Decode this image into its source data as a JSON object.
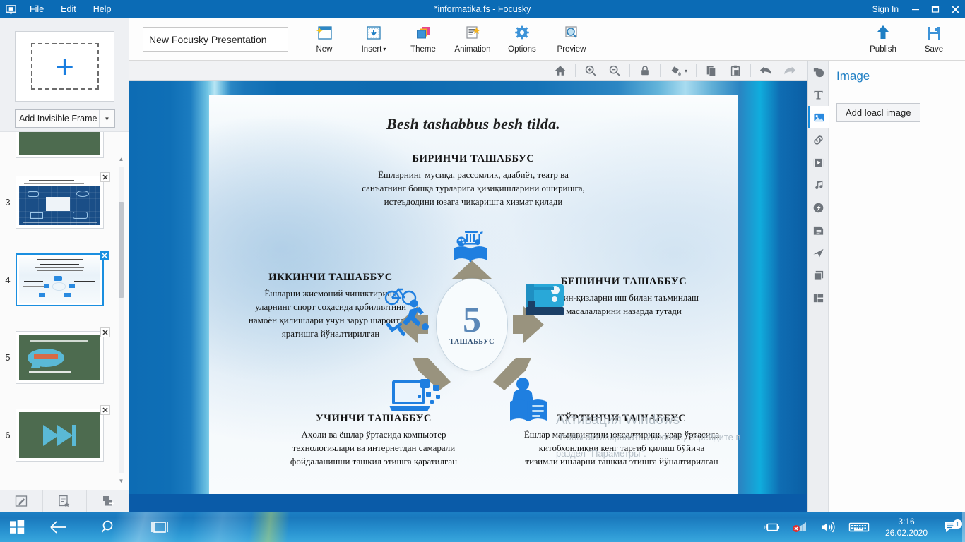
{
  "titlebar": {
    "menus": [
      "File",
      "Edit",
      "Help"
    ],
    "title": "*informatika.fs - Focusky",
    "signin": "Sign In",
    "minimize": "–",
    "restore": "❐",
    "close": "✕"
  },
  "ribbon": {
    "presentation_title": "New Focusky Presentation",
    "tools": [
      {
        "label": "New",
        "icon": "new-slide-icon"
      },
      {
        "label": "Insert",
        "icon": "insert-icon",
        "caret": "▾"
      },
      {
        "label": "Theme",
        "icon": "theme-icon"
      },
      {
        "label": "Animation",
        "icon": "animation-icon"
      },
      {
        "label": "Options",
        "icon": "options-gear-icon"
      },
      {
        "label": "Preview",
        "icon": "preview-magnifier-icon"
      }
    ],
    "right_tools": [
      {
        "label": "Publish",
        "icon": "publish-upload-icon"
      },
      {
        "label": "Save",
        "icon": "save-floppy-icon"
      }
    ]
  },
  "left_panel": {
    "add_frame_label": "Add Invisible Frame",
    "add_frame_caret": "▼",
    "plus": "+",
    "thumbnails": [
      {
        "number": "",
        "kind": "green-partial",
        "selected": false
      },
      {
        "number": "3",
        "kind": "blueprint",
        "selected": false
      },
      {
        "number": "4",
        "kind": "current-slide",
        "selected": true
      },
      {
        "number": "5",
        "kind": "green-bubble",
        "bubble_text": "Internet",
        "caption": "Axborot nima?",
        "selected": false
      },
      {
        "number": "6",
        "kind": "green-next",
        "selected": false
      }
    ],
    "scroll_up": "▲",
    "scroll_down": "▼",
    "bottom_buttons": [
      "edit-frame-icon",
      "add-note-icon",
      "duplicate-frame-icon"
    ]
  },
  "canvas_toolbar": {
    "buttons": [
      "home-icon",
      "zoom-in-icon",
      "zoom-out-icon",
      "lock-icon",
      "fill-color-icon",
      "copy-icon",
      "paste-icon",
      "undo-icon",
      "redo-icon"
    ],
    "fill_caret": "▾"
  },
  "slide": {
    "title": "Besh tashabbus besh tilda.",
    "center": {
      "number": "5",
      "label": "ТАШАББУС"
    },
    "blocks": [
      {
        "id": "blk1",
        "heading": "БИРИНЧИ ТАШАББУС",
        "lines": [
          "Ёшларнинг мусиқа, рассомлик, адабиёт, театр ва",
          "санъатнинг бошқа турларига қизиқишларини оширишга,",
          "истеъдодини юзага чиқаришга хизмат қилади"
        ]
      },
      {
        "id": "blk2",
        "heading": "ИККИНЧИ ТАШАББУС",
        "lines": [
          "Ёшларни жисмоний чиниктириш,",
          "уларнинг спорт соҳасида қобилиятини",
          "намоён қилишлари учун зарур шароитлар",
          "яратишга йўналтирилган"
        ]
      },
      {
        "id": "blk5",
        "heading": "БЕШИНЧИ ТАШАББУС",
        "lines": [
          "Хотин-қизларни иш билан таъминлаш",
          "масалаларини назарда тутади"
        ]
      },
      {
        "id": "blk3",
        "heading": "УЧИНЧИ ТАШАББУС",
        "lines": [
          "Аҳоли ва ёшлар ўртасида компьютер",
          "технологиялари ва интернетдан самарали",
          "фойдаланишни ташкил этишга қаратилган"
        ]
      },
      {
        "id": "blk4",
        "heading": "ТЎРТИНЧИ ТАШАББУС",
        "lines": [
          "Ёшлар маънавиятини юксалтириш, улар ўртасида",
          "китобхонликни кенг тарғиб қилиш бўйича",
          "тизимли ишларни ташкил этишга йўналтирилган"
        ]
      }
    ],
    "icons": [
      "culture-book-icon",
      "sports-bicycle-runner-icon",
      "sewing-machine-icon",
      "laptop-data-icon",
      "reading-person-icon"
    ]
  },
  "watermark": {
    "line1": "Активация Windows",
    "line2": "Чтобы активировать Windows, перейдите в",
    "line3": "раздел \"Параметры\"."
  },
  "right_panel": {
    "title": "Image",
    "add_button": "Add loacl image",
    "rail_icons": [
      "shape-icon",
      "text-icon",
      "image-icon",
      "link-icon",
      "video-icon",
      "music-icon",
      "flash-icon",
      "content-icon",
      "animation-path-icon",
      "layers-icon",
      "layout-icon"
    ]
  },
  "taskbar": {
    "start": "start-icon",
    "back": "back-arrow-icon",
    "search": "search-icon",
    "taskview": "task-view-icon",
    "tray": [
      "battery-icon",
      "network-disconnected-icon",
      "volume-icon",
      "keyboard-icon"
    ],
    "time": "3:16",
    "date": "26.02.2020",
    "notification_count": "1"
  },
  "colors": {
    "accent_blue": "#0b6bb5",
    "link_blue": "#1f7fc4",
    "slide_text": "#141414",
    "arrow_brown": "#99937e",
    "icon_blue": "#1a7ee0"
  }
}
